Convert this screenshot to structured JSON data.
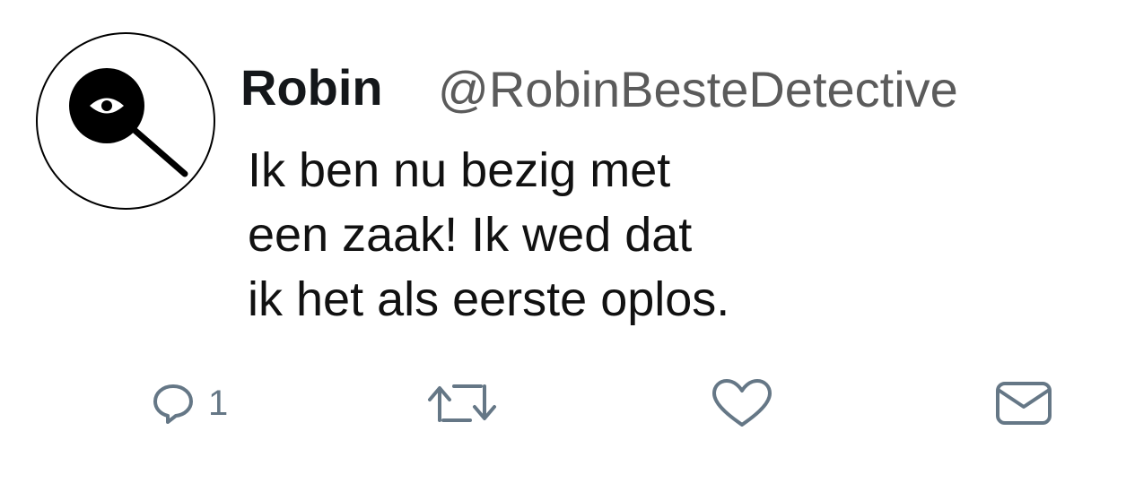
{
  "tweet": {
    "author": {
      "display_name": "Robin",
      "handle": "@RobinBesteDetective",
      "avatar_icon": "magnifying-glass-eye-icon"
    },
    "text_lines": [
      "Ik ben nu bezig met",
      "een zaak! Ik wed dat",
      "ik het als eerste oplos."
    ],
    "actions": {
      "reply": {
        "icon": "reply-icon",
        "count": "1"
      },
      "retweet": {
        "icon": "retweet-icon"
      },
      "like": {
        "icon": "heart-icon"
      },
      "direct_message": {
        "icon": "envelope-icon"
      }
    }
  },
  "colors": {
    "text": "#111111",
    "handle": "#5b5b5b",
    "action_icon": "#657786",
    "background": "#ffffff"
  }
}
